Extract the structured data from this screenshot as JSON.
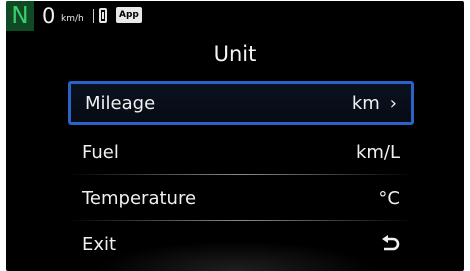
{
  "status": {
    "gear": "N",
    "speed": "0",
    "speed_unit": "km/h",
    "app_badge": "App"
  },
  "title": "Unit",
  "menu": {
    "items": [
      {
        "label": "Mileage",
        "value": "km",
        "selected": true
      },
      {
        "label": "Fuel",
        "value": "km/L"
      },
      {
        "label": "Temperature",
        "value": "°C"
      },
      {
        "label": "Exit"
      }
    ]
  },
  "colors": {
    "selection_border": "#2a62c8",
    "gear_bg": "#0f4a24",
    "gear_text": "#39d06a"
  },
  "icons": {
    "selected_chevron": "chevron-right-icon",
    "exit": "back-arrow-icon",
    "phone": "phone-icon"
  }
}
